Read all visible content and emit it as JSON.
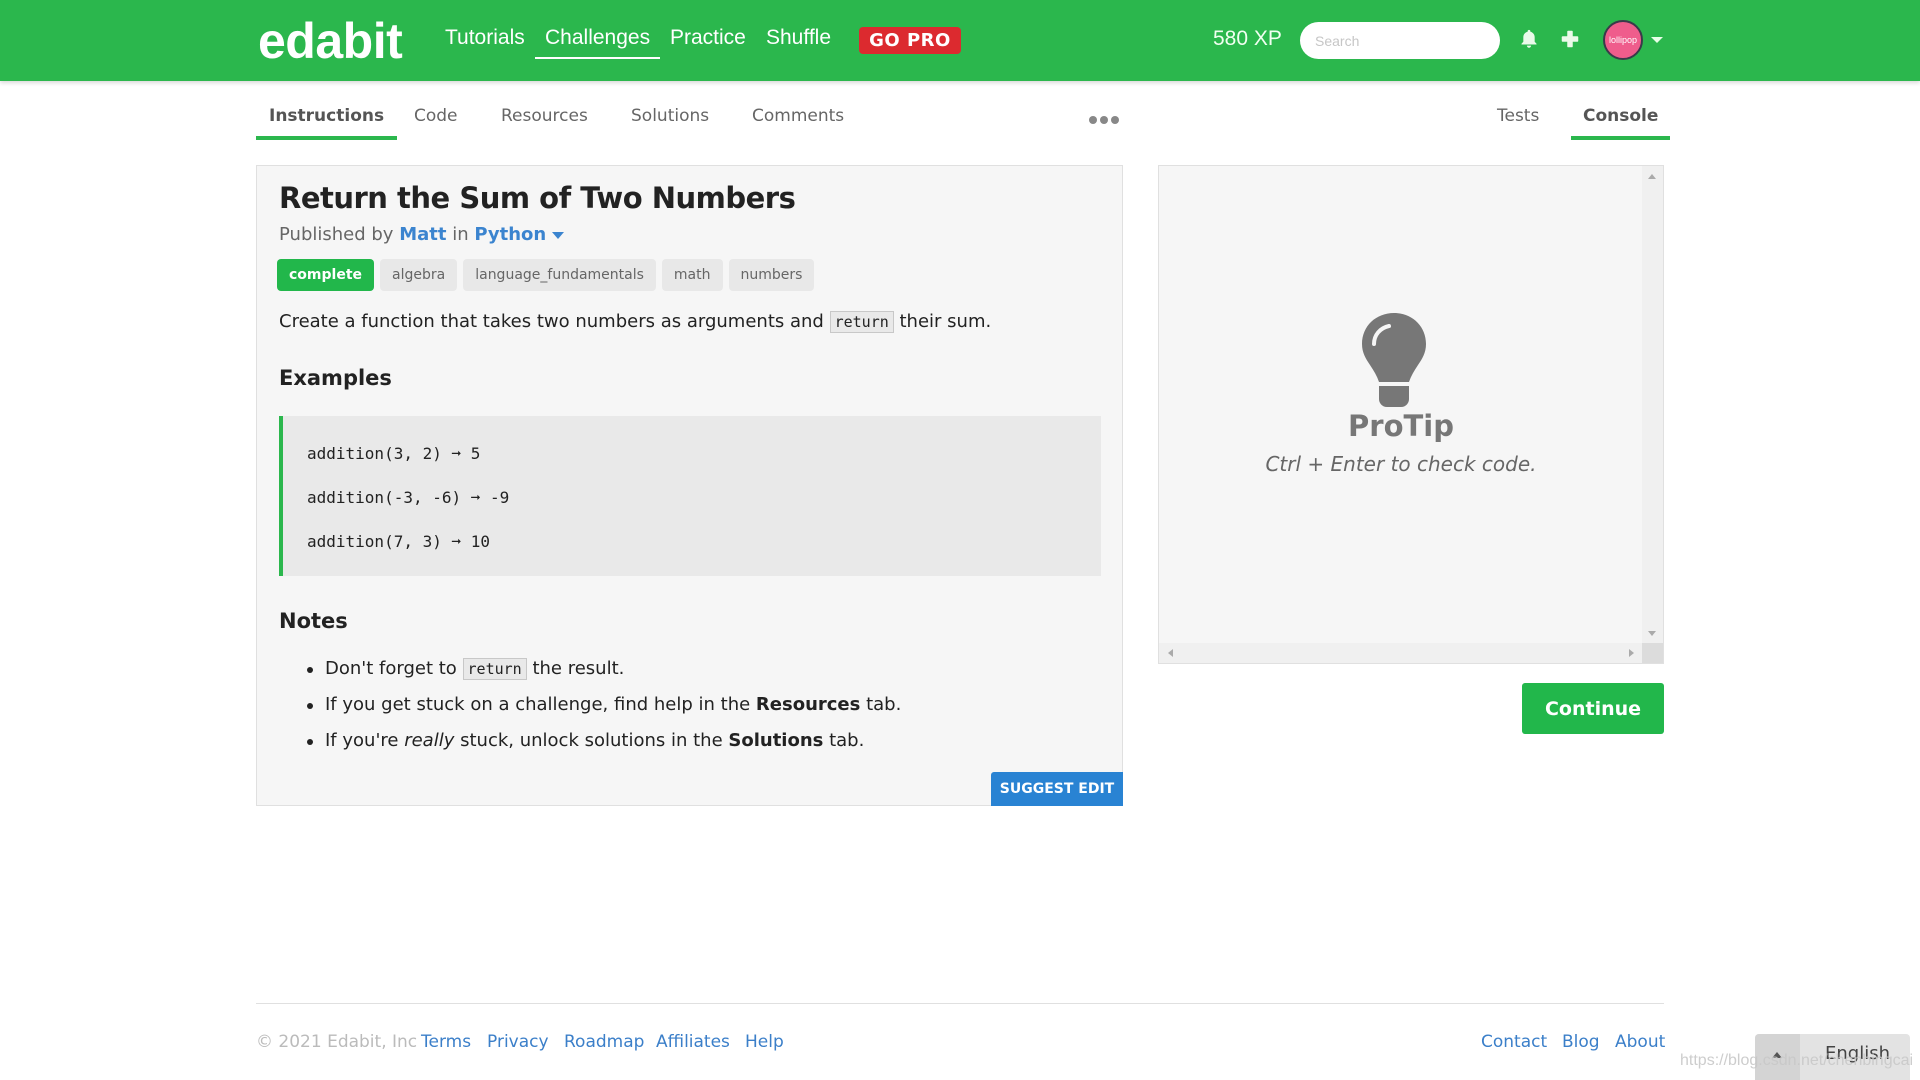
{
  "header": {
    "logo": "edabit",
    "nav": [
      {
        "label": "Tutorials",
        "active": false
      },
      {
        "label": "Challenges",
        "active": true
      },
      {
        "label": "Practice",
        "active": false
      },
      {
        "label": "Shuffle",
        "active": false
      }
    ],
    "go_pro": "GO PRO",
    "xp": "580 XP",
    "search_placeholder": "Search",
    "icons": [
      "bell-icon",
      "plus-icon"
    ],
    "avatar_text": "lollipop",
    "brand_color": "#2bb74d"
  },
  "tabs_left": [
    {
      "label": "Instructions",
      "active": true
    },
    {
      "label": "Code",
      "active": false
    },
    {
      "label": "Resources",
      "active": false
    },
    {
      "label": "Solutions",
      "active": false
    },
    {
      "label": "Comments",
      "active": false
    }
  ],
  "tabs_right": [
    {
      "label": "Tests",
      "active": false
    },
    {
      "label": "Console",
      "active": true
    }
  ],
  "challenge": {
    "title": "Return the Sum of Two Numbers",
    "published_prefix": "Published by",
    "author": "Matt",
    "in_word": "in",
    "language": "Python",
    "tags": [
      "complete",
      "algebra",
      "language_fundamentals",
      "math",
      "numbers"
    ],
    "description": {
      "before": "Create a function that takes two numbers as arguments and",
      "code": "return",
      "after": "their sum."
    },
    "examples_heading": "Examples",
    "examples": [
      "addition(3, 2) ➞ 5",
      "addition(-3, -6) ➞ -9",
      "addition(7, 3) ➞ 10"
    ],
    "notes_heading": "Notes",
    "notes": [
      {
        "before": "Don't forget to",
        "code": "return",
        "after": "the result."
      },
      {
        "before": "If you get stuck on a challenge, find help in the",
        "bold": "Resources",
        "after": "tab."
      },
      {
        "before": "If you're",
        "italic": "really",
        "middle": "stuck, unlock solutions in the",
        "bold": "Solutions",
        "after": "tab."
      }
    ],
    "suggest_edit": "SUGGEST EDIT"
  },
  "console": {
    "protip_title": "ProTip",
    "protip_text": "Ctrl + Enter to check code."
  },
  "continue_label": "Continue",
  "footer": {
    "copyright": "© 2021 Edabit, Inc",
    "left_links": [
      "Terms",
      "Privacy",
      "Roadmap",
      "Affiliates",
      "Help"
    ],
    "right_links": [
      "Contact",
      "Blog",
      "About"
    ],
    "language": "English",
    "watermark": "https://blog.csdn.net/chenbingcai"
  }
}
